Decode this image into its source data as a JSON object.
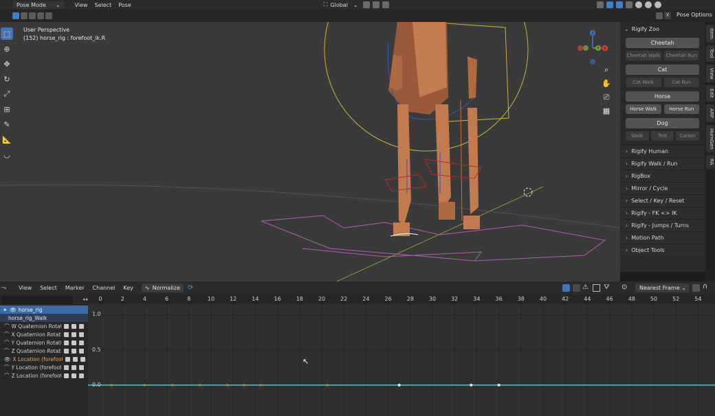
{
  "header": {
    "mode": "Pose Mode",
    "menus": [
      "View",
      "Select",
      "Pose"
    ],
    "transform_orientation": "Global",
    "pose_options": "Pose Options",
    "x_label": "X"
  },
  "viewport": {
    "perspective": "User Perspective",
    "object_info": "(152) horse_rig : forefoot_ik.R",
    "gizmo_axes": [
      "X",
      "Y",
      "Z"
    ]
  },
  "npanel": {
    "title": "Rigify Zoo",
    "animals": [
      {
        "name": "Cheetah",
        "actions": [
          "Cheetah Walk",
          "Cheetah Run"
        ],
        "enabled": false
      },
      {
        "name": "Cat",
        "actions": [
          "Cat Walk",
          "Cat Run"
        ],
        "enabled": false
      },
      {
        "name": "Horse",
        "actions": [
          "Horse Walk",
          "Horse Run"
        ],
        "enabled": true
      },
      {
        "name": "Dog",
        "actions": [
          "Walk",
          "Trot",
          "Canter"
        ],
        "enabled": false
      }
    ],
    "sections": [
      "Rigify Human",
      "Rigify Walk / Run",
      "RigBox",
      "Mirror / Cycle",
      "Select  / Key / Reset",
      "Rigify - FK <> IK",
      "Rigify - Jumps / Turns",
      "Motion Path",
      "Object Tools"
    ],
    "tabs": [
      "Item",
      "Tool",
      "View",
      "Edit",
      "ARP",
      "HumGen",
      "RA"
    ]
  },
  "graph_editor": {
    "menus": [
      "View",
      "Select",
      "Marker",
      "Channel",
      "Key"
    ],
    "normalize": "Normalize",
    "snap": "Nearest Frame",
    "object": "horse_rig",
    "action": "horse_rig_Walk",
    "channels": [
      {
        "name": "W Quaternion Rotatio",
        "selected": false
      },
      {
        "name": "X Quaternion Rotatio",
        "selected": false
      },
      {
        "name": "Y Quaternion Rotatio",
        "selected": false
      },
      {
        "name": "Z Quaternion Rotatio",
        "selected": false
      },
      {
        "name": "X Location (forefoot_",
        "selected": true
      },
      {
        "name": "Y Location (forefoot_l",
        "selected": false
      },
      {
        "name": "Z Location (forefoot_l",
        "selected": false
      }
    ],
    "frame_ticks": [
      "0",
      "2",
      "4",
      "6",
      "8",
      "10",
      "12",
      "14",
      "16",
      "18",
      "20",
      "22",
      "24",
      "26",
      "28",
      "30",
      "32",
      "34",
      "36",
      "38",
      "40",
      "42",
      "44",
      "46",
      "48",
      "50",
      "52",
      "54"
    ],
    "y_ticks": [
      "1.0",
      "0.5",
      "0.0"
    ],
    "keyframes": [
      1,
      4,
      6.5,
      9,
      11.5,
      13,
      14.5,
      20.5,
      27,
      33.5,
      36
    ]
  },
  "colors": {
    "accent": "#4772b3",
    "curve": "#3fa6a8",
    "selected_channel": "#f1a33a"
  }
}
